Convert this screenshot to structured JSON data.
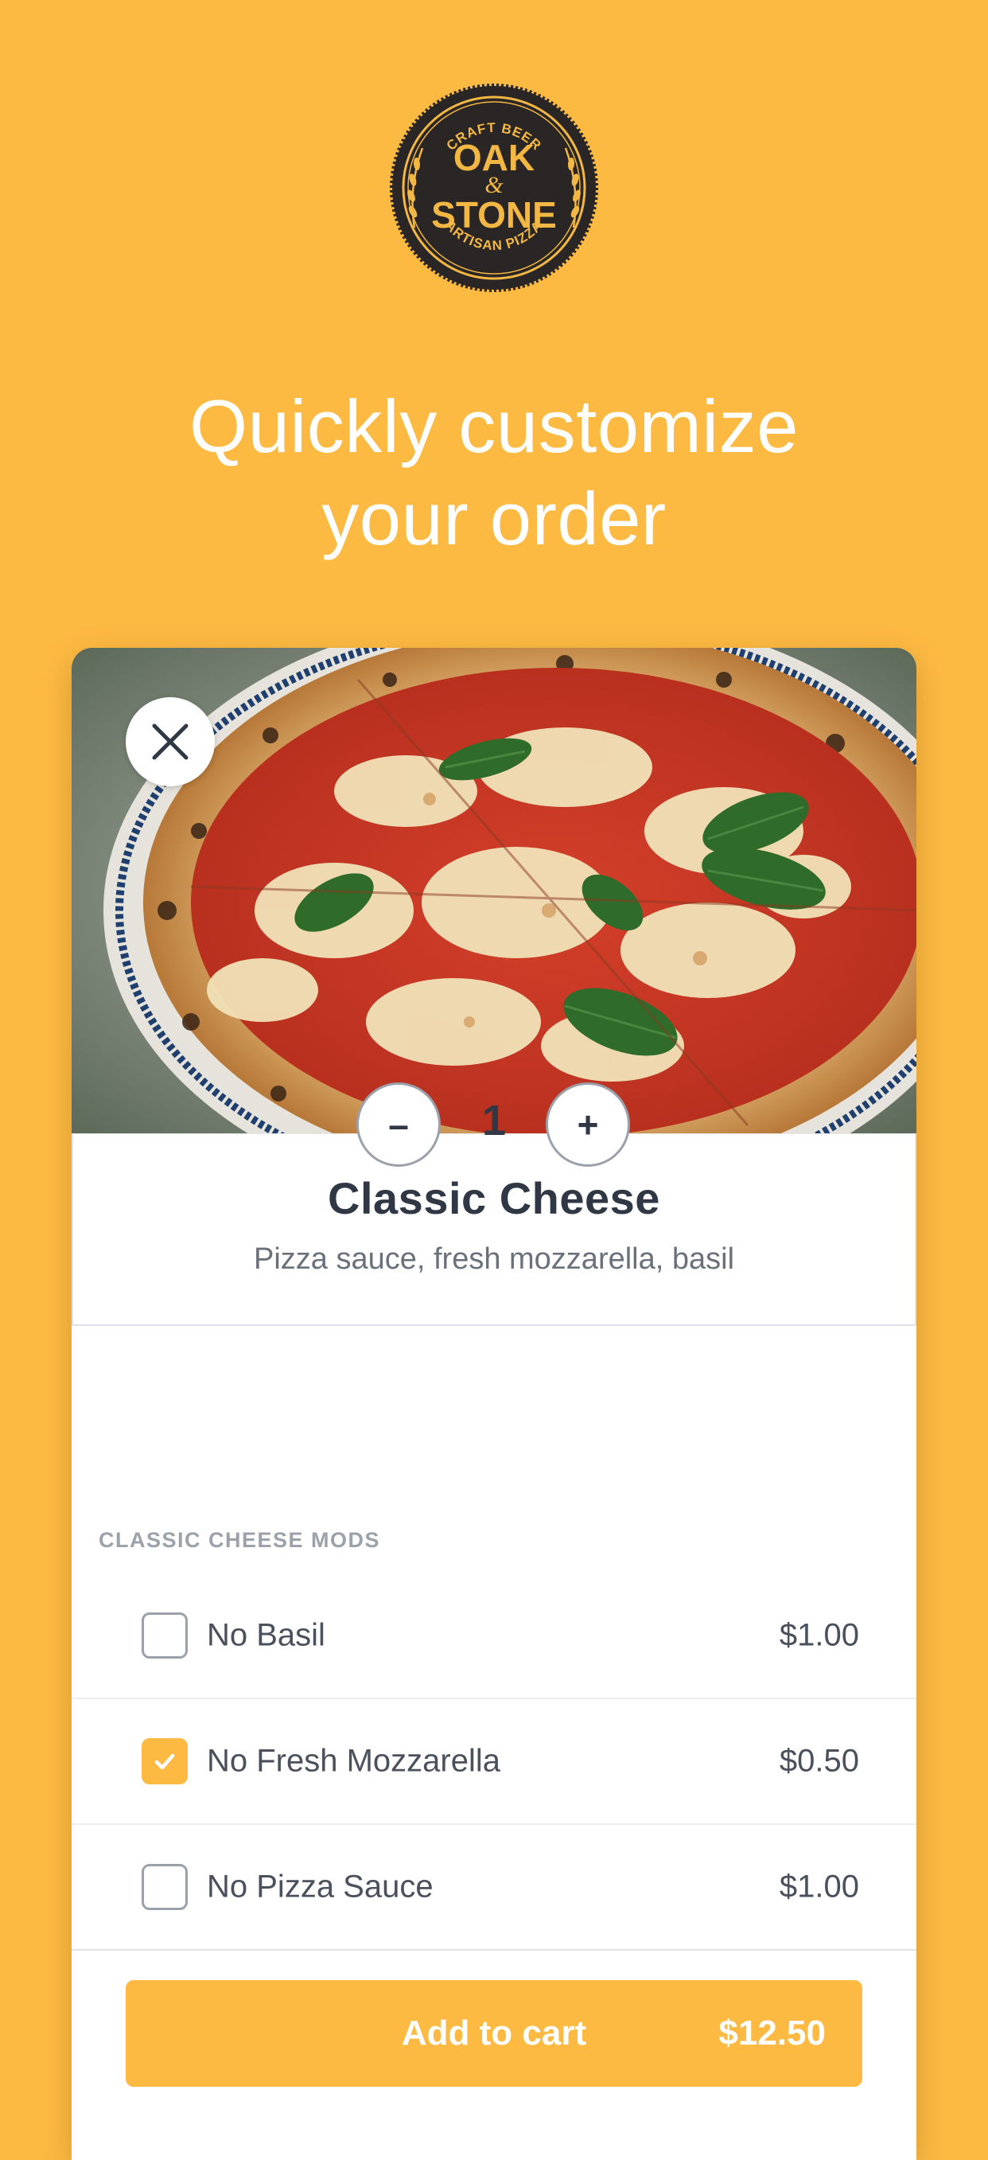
{
  "brand": {
    "logo_top": "CRAFT BEER",
    "logo_line1": "OAK",
    "logo_amp": "&",
    "logo_line2": "STONE",
    "logo_bottom": "ARTISAN PIZZA"
  },
  "headline": {
    "line1": "Quickly customize",
    "line2": "your order"
  },
  "item": {
    "name": "Classic Cheese",
    "description": "Pizza sauce, fresh mozzarella, basil",
    "quantity": "1",
    "minus_label": "–",
    "plus_label": "+"
  },
  "mods": {
    "header": "CLASSIC CHEESE MODS",
    "items": [
      {
        "label": "No Basil",
        "price": "$1.00",
        "checked": false
      },
      {
        "label": "No Fresh Mozzarella",
        "price": "$0.50",
        "checked": true
      },
      {
        "label": "No Pizza Sauce",
        "price": "$1.00",
        "checked": false
      }
    ]
  },
  "cart": {
    "label": "Add to cart",
    "total": "$12.50"
  },
  "colors": {
    "background": "#FDBA43",
    "accent": "#FDBA43",
    "text_dark": "#2F3844",
    "text_muted": "#6B717B"
  }
}
